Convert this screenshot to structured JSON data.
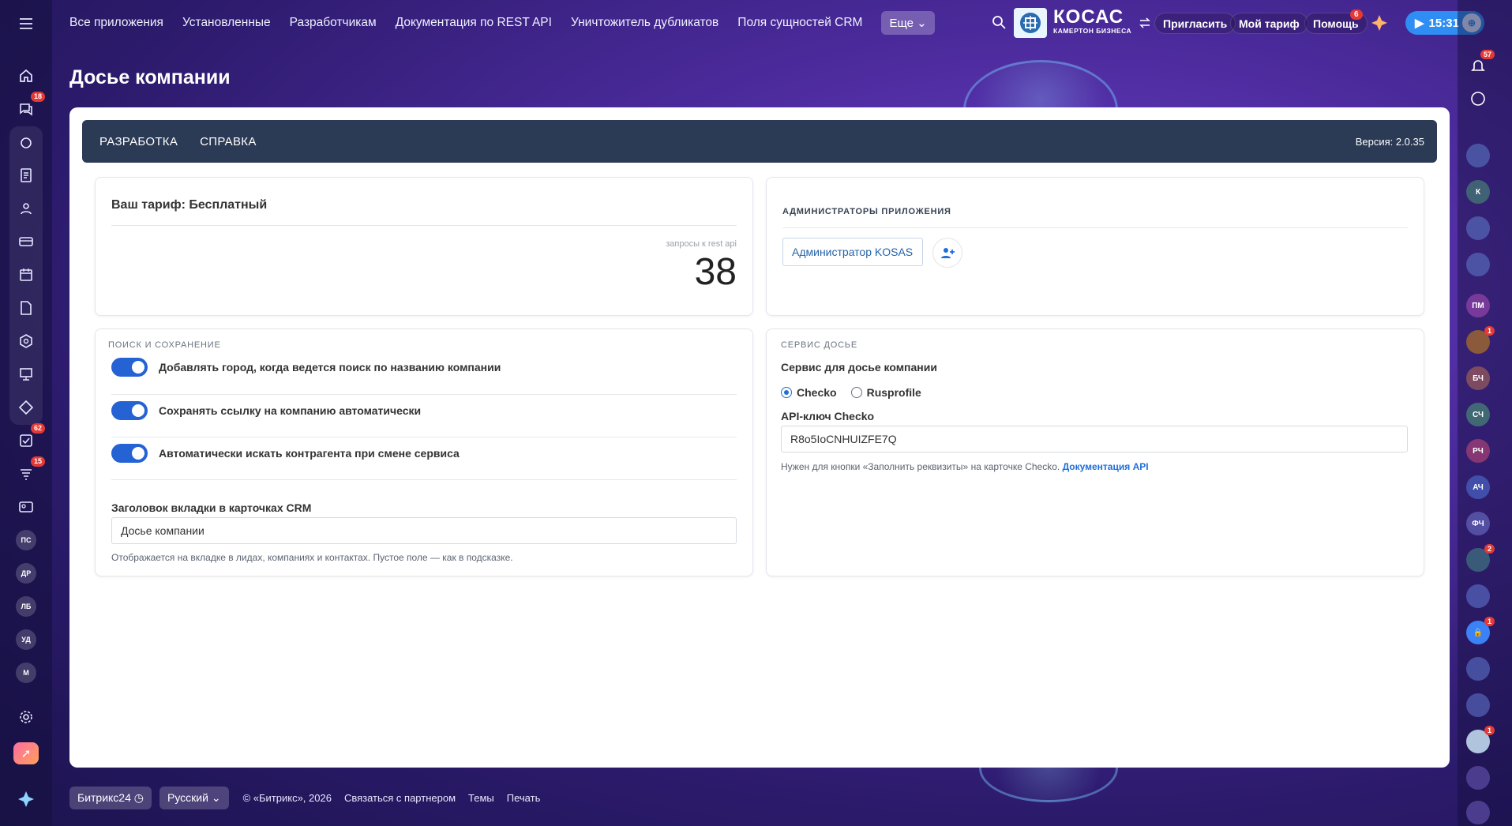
{
  "top_nav": {
    "links": [
      "Все приложения",
      "Установленные",
      "Разработчикам",
      "Документация по REST API",
      "Уничтожитель дубликатов",
      "Поля сущностей CRM"
    ],
    "more_label": "Еще",
    "invite_label": "Пригласить",
    "tariff_label": "Мой тариф",
    "help_label": "Помощь",
    "help_badge": "6",
    "time": "15:31"
  },
  "logo": {
    "title": "КОСАС",
    "subtitle": "КАМЕРТОН БИЗНЕСА"
  },
  "left_sidebar": {
    "chat_badge": "18",
    "tasks_badge": "62",
    "feed_badge": "15",
    "circles": [
      "ПС",
      "ДР",
      "ЛБ",
      "УД",
      "М"
    ]
  },
  "right_sidebar": {
    "bell_badge": "57",
    "circles": [
      "К",
      "ПМ",
      "БЧ",
      "СЧ",
      "РЧ",
      "АЧ",
      "ФЧ"
    ],
    "avatar_badges": [
      "1",
      "2",
      "1",
      "1"
    ]
  },
  "page": {
    "title": "Досье компании"
  },
  "app_nav": {
    "tabs": [
      "РАЗРАБОТКА",
      "СПРАВКА"
    ],
    "version": "Версия: 2.0.35"
  },
  "tariff": {
    "title": "Ваш тариф: Бесплатный",
    "rest_label": "запросы к rest api",
    "rest_value": "38"
  },
  "admins": {
    "section": "АДМИНИСТРАТОРЫ ПРИЛОЖЕНИЯ",
    "chip": "Администратор KOSAS"
  },
  "search_save": {
    "section": "ПОИСК И СОХРАНЕНИЕ",
    "toggles": [
      "Добавлять город, когда ведется поиск по названию компании",
      "Сохранять ссылку на компанию автоматически",
      "Автоматически искать контрагента при смене сервиса"
    ],
    "tab_title_label": "Заголовок вкладки в карточках CRM",
    "tab_title_value": "Досье компании",
    "tab_title_hint": "Отображается на вкладке в лидах, компаниях и контактах. Пустое поле — как в подсказке."
  },
  "service": {
    "section": "СЕРВИС ДОСЬЕ",
    "service_label": "Сервис для досье компании",
    "options": [
      "Checko",
      "Rusprofile"
    ],
    "selected": "Checko",
    "api_label": "API-ключ Checko",
    "api_value": "R8o5IoCNHUIZFE7Q",
    "hint": "Нужен для кнопки «Заполнить реквизиты» на карточке Checko.",
    "hint_link": "Документация API"
  },
  "footer": {
    "brand": "Битрикс24",
    "language": "Русский",
    "copyright": "© «Битрикс», 2026",
    "links": [
      "Связаться с партнером",
      "Темы",
      "Печать"
    ]
  }
}
